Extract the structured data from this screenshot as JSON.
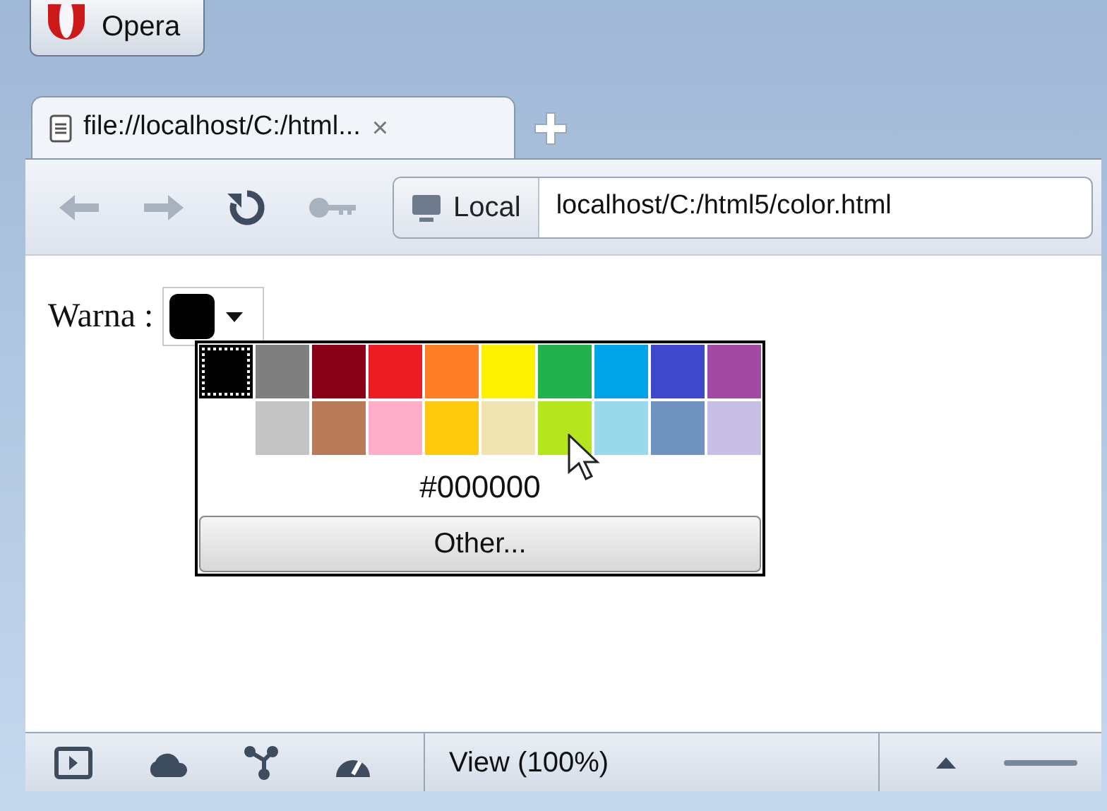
{
  "menu_button": {
    "label": "Opera"
  },
  "tabs": [
    {
      "label": "file://localhost/C:/html...",
      "close": "×",
      "selected": true
    }
  ],
  "address_bar": {
    "badge": "Local",
    "url": "localhost/C:/html5/color.html"
  },
  "page": {
    "label": "Warna :",
    "palette": {
      "rows": [
        [
          {
            "color": "#000000",
            "selected": true
          },
          {
            "color": "#7f7f7f",
            "selected": false
          },
          {
            "color": "#880015",
            "selected": false
          },
          {
            "color": "#ed1c24",
            "selected": false
          },
          {
            "color": "#ff7f27",
            "selected": false
          },
          {
            "color": "#fff200",
            "selected": false
          },
          {
            "color": "#22b14c",
            "selected": false
          },
          {
            "color": "#00a2e8",
            "selected": false
          },
          {
            "color": "#3f48cc",
            "selected": false
          },
          {
            "color": "#a349a4",
            "selected": false
          }
        ],
        [
          {
            "color": "#c3c3c3",
            "selected": false
          },
          {
            "color": "#b97a57",
            "selected": false
          },
          {
            "color": "#ffaec9",
            "selected": false
          },
          {
            "color": "#ffc90e",
            "selected": false
          },
          {
            "color": "#efe4b0",
            "selected": false
          },
          {
            "color": "#b5e61d",
            "selected": false
          },
          {
            "color": "#99d9ea",
            "selected": false
          },
          {
            "color": "#7092be",
            "selected": false
          },
          {
            "color": "#c8bfe7",
            "selected": false
          }
        ]
      ],
      "hex": "#000000",
      "other_button": "Other..."
    }
  },
  "status_bar": {
    "zoom": "View (100%)"
  }
}
